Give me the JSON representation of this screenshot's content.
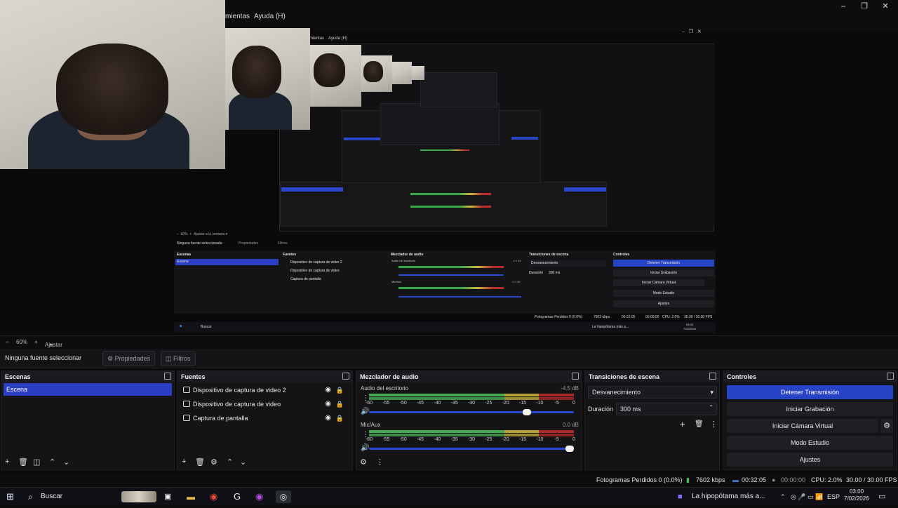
{
  "window": {
    "menu_visible": [
      "mientas",
      "Ayuda (H)"
    ],
    "controls": [
      "–",
      "❐",
      "✕"
    ]
  },
  "preview": {
    "inner_menu": [
      "mientas",
      "Ayuda (H)"
    ],
    "inner": {
      "zoom": "60%",
      "fit": "Ajustar a la ventana",
      "no_source": "Ninguna fuente seleccionada",
      "props": "Propiedades",
      "filters": "Filtros",
      "panels": {
        "scenes": "Escenas",
        "sources": "Fuentes",
        "mixer": "Mezclador de audio",
        "transitions": "Transiciones de escena",
        "controls": "Controles"
      },
      "scene_item": "Escena",
      "sources": [
        "Dispositivo de captura de video 2",
        "Dispositivo de captura de video",
        "Captura de pantalla"
      ],
      "mixer": {
        "desktop": "Audio del escritorio",
        "desktop_db": "-4.5 dB",
        "mic": "Mic/Aux",
        "mic_db": "0.0 dB"
      },
      "transition": "Desvanecimiento",
      "duration_label": "Duración",
      "duration_value": "300 ms",
      "controls": [
        "Detener Transmisión",
        "Iniciar Grabación",
        "Iniciar Cámara Virtual",
        "Modo Estudio",
        "Ajustes"
      ],
      "status": {
        "dropped": "Fotogramas Perdidos 0 (0.0%)",
        "kbps": "7602 kbps",
        "stream_time": "00:22:05",
        "rec_time": "00:00:00",
        "cpu": "CPU: 2.0%",
        "fps": "30.00 / 30.00 FPS"
      },
      "taskbar": {
        "search": "Buscar",
        "notification": "La hipopótama más a...",
        "time": "03:00",
        "date": "7/02/2026"
      }
    }
  },
  "zoombar": {
    "minus": "–",
    "zoom": "60%",
    "plus": "+",
    "fit": "Ajustar a la ventana"
  },
  "source_toolbar": {
    "no_source": "Ninguna fuente seleccionar",
    "properties": "Propiedades",
    "filters": "Filtros"
  },
  "scenes": {
    "title": "Escenas",
    "items": [
      "Escena"
    ]
  },
  "sources": {
    "title": "Fuentes",
    "items": [
      {
        "name": "Dispositivo de captura de video 2",
        "icon": "camera-icon"
      },
      {
        "name": "Dispositivo de captura de video",
        "icon": "camera-icon"
      },
      {
        "name": "Captura de pantalla",
        "icon": "monitor-icon"
      }
    ]
  },
  "mixer": {
    "title": "Mezclador de audio",
    "channels": [
      {
        "name": "Audio del escritorio",
        "db": "-4.5 dB",
        "volume": 0.79
      },
      {
        "name": "Mic/Aux",
        "db": "0.0 dB",
        "volume": 1.0
      }
    ],
    "ticks": [
      "-60",
      "-55",
      "-50",
      "-45",
      "-40",
      "-35",
      "-30",
      "-25",
      "-20",
      "-15",
      "-10",
      "-5",
      "0"
    ]
  },
  "transitions": {
    "title": "Transiciones de escena",
    "selected": "Desvanecimiento",
    "duration_label": "Duración",
    "duration_value": "300 ms"
  },
  "controls": {
    "title": "Controles",
    "buttons": {
      "stream": "Detener Transmisión",
      "record": "Iniciar Grabación",
      "virtual_cam": "Iniciar Cámara Virtual",
      "studio": "Modo Estudio",
      "settings": "Ajustes"
    }
  },
  "status": {
    "dropped": "Fotogramas Perdidos 0 (0.0%)",
    "kbps": "7602 kbps",
    "stream_time": "00:32:05",
    "rec_time": "00:00:00",
    "cpu": "CPU: 2.0%",
    "fps": "30.00 / 30.00 FPS"
  },
  "taskbar": {
    "search": "Buscar",
    "notification": "La hipopótama más a...",
    "lang": "ESP",
    "time": "03:00",
    "date": "7/02/2026"
  },
  "colors": {
    "accent": "#2a44c8",
    "meter_green": "#48a854",
    "meter_yellow": "#b3a23a",
    "meter_red": "#a72b2b",
    "bg": "#141416"
  }
}
